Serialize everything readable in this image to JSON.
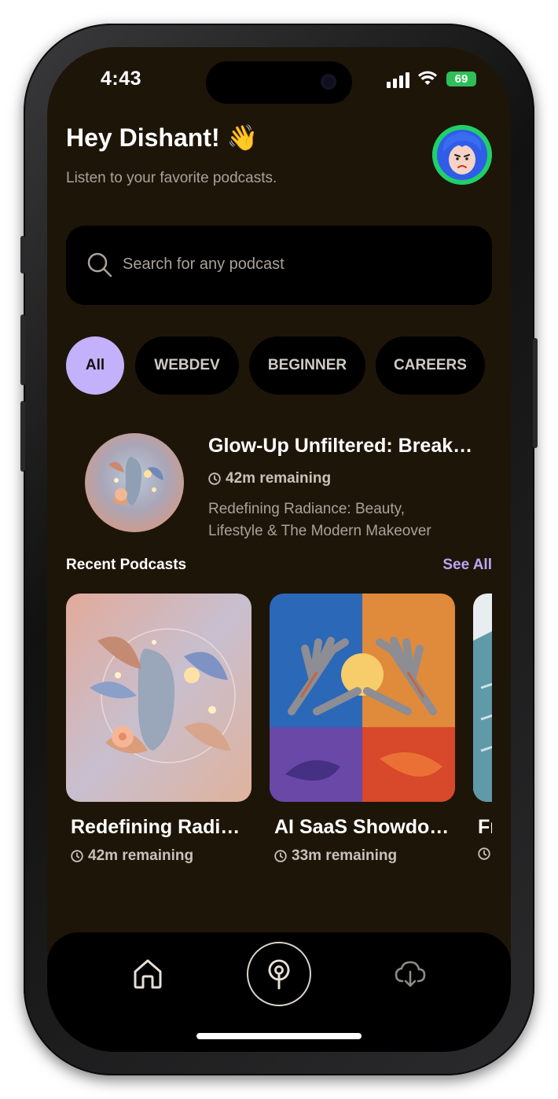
{
  "status_bar": {
    "time": "4:43",
    "battery": "69"
  },
  "header": {
    "greeting": "Hey Dishant! 👋",
    "subtitle": "Listen to your favorite podcasts."
  },
  "search": {
    "placeholder": "Search for any podcast"
  },
  "categories": [
    {
      "label": "All",
      "active": true
    },
    {
      "label": "WEBDEV",
      "active": false
    },
    {
      "label": "BEGINNER",
      "active": false
    },
    {
      "label": "CAREERS",
      "active": false
    }
  ],
  "now_playing": {
    "title": "Glow-Up Unfiltered: Breaking Beauty",
    "remaining": "42m remaining",
    "description": "Redefining Radiance: Beauty, Lifestyle & The Modern Makeover"
  },
  "recent": {
    "title": "Recent Podcasts",
    "see_all": "See All",
    "items": [
      {
        "title": "Redefining Radiance: Beauty, Lifestyle",
        "remaining": "42m remaining"
      },
      {
        "title": "AI SaaS Showdown: An Overview",
        "remaining": "33m remaining"
      },
      {
        "title": "From Your Desk",
        "remaining": ""
      }
    ]
  },
  "tabbar": {
    "items": [
      {
        "name": "home",
        "icon": "home-icon"
      },
      {
        "name": "podcasts",
        "icon": "podcast-icon"
      },
      {
        "name": "downloads",
        "icon": "cloud-download-icon"
      }
    ]
  },
  "colors": {
    "background": "#1e1509",
    "accent": "#c3b2fb",
    "link": "#b9a7f6"
  }
}
